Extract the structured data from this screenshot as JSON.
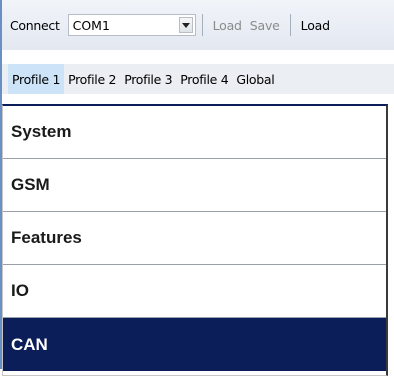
{
  "toolbar": {
    "connect_label": "Connect",
    "port_value": "COM1",
    "load_label": "Load",
    "save_label": "Save",
    "load2_label": "Load"
  },
  "profiles": [
    "Profile 1",
    "Profile 2",
    "Profile 3",
    "Profile 4",
    "Global"
  ],
  "active_profile": "Profile 1",
  "menu": [
    "System",
    "GSM",
    "Features",
    "IO",
    "CAN"
  ],
  "selected_menu": "CAN",
  "colors": {
    "selection": "#0c1e5a",
    "active_tab": "#cde4f8"
  }
}
